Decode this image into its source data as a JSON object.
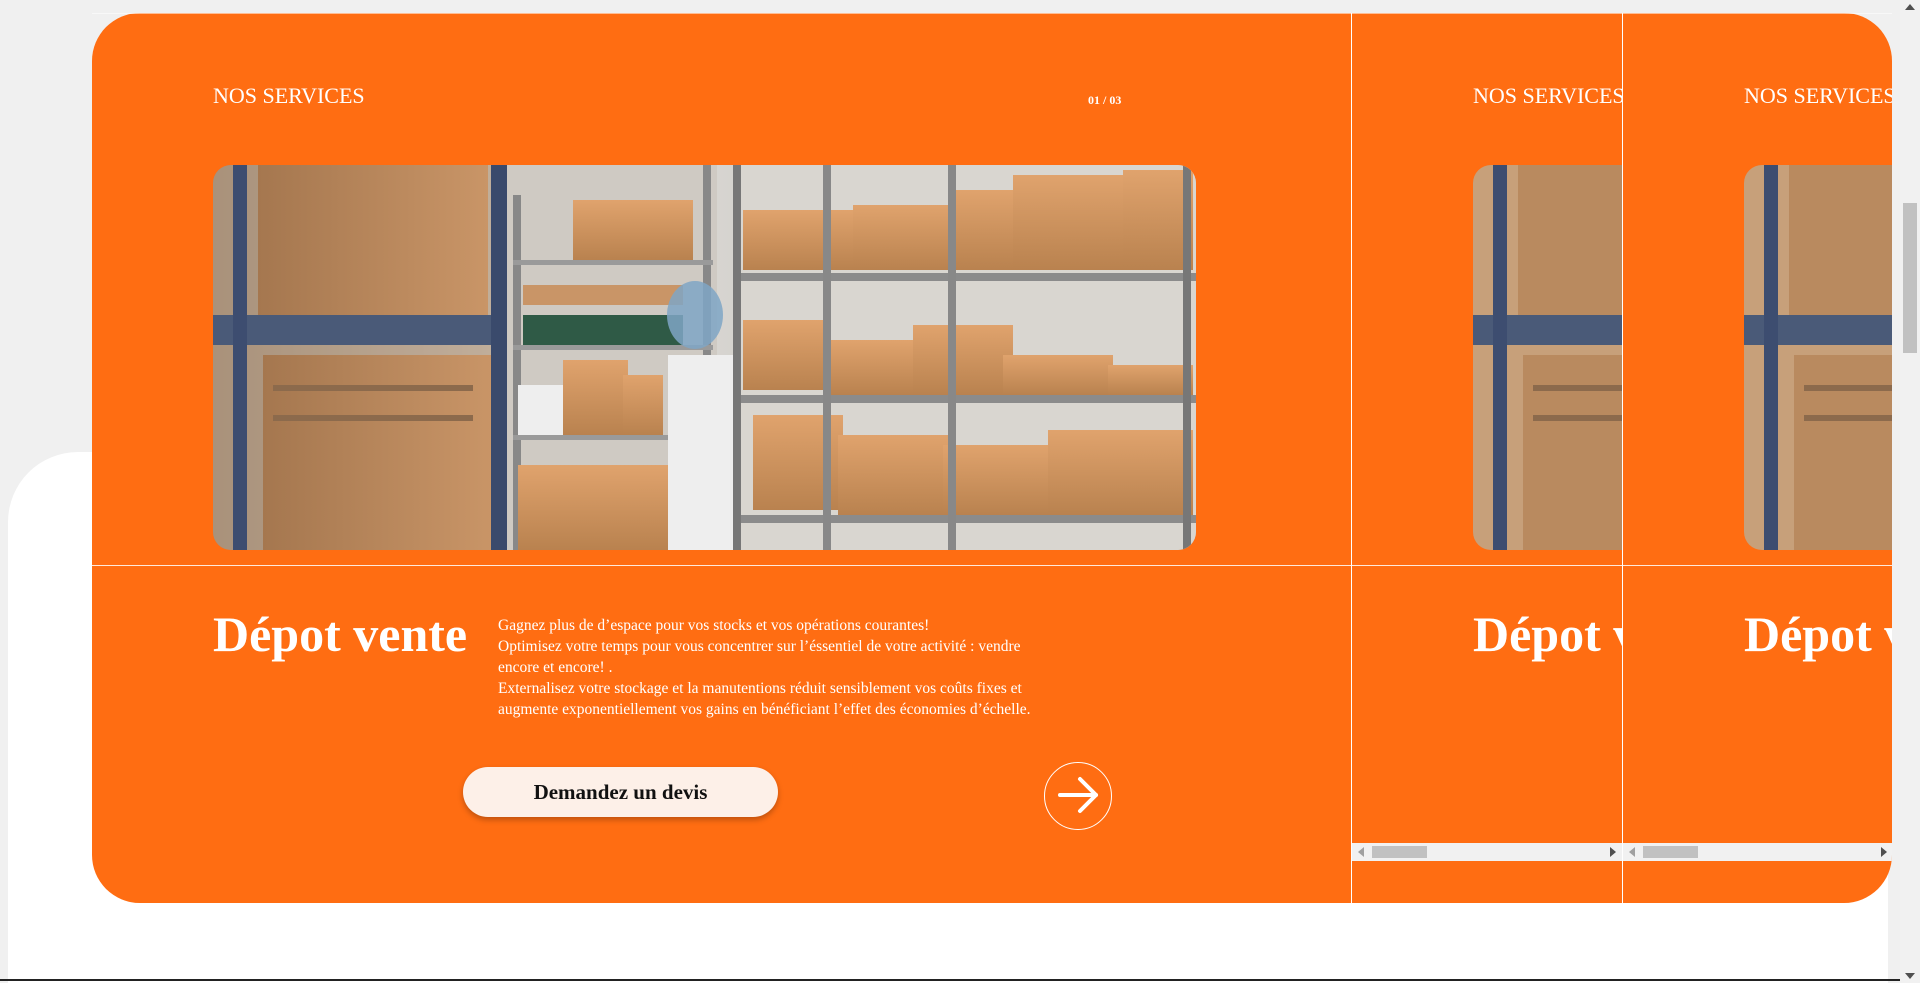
{
  "section_label": "NOS SERVICES",
  "pager": "01 / 03",
  "photo_alt": "warehouse-shelves-photo",
  "service": {
    "heading": "Dépot vente",
    "description_lines": [
      "Gagnez plus de d’espace pour vos stocks et vos opérations courantes!",
      "Optimisez votre temps pour vous concentrer sur l’éssentiel de votre activité : vendre encore et encore! .",
      "Externalisez votre stockage et la manutentions réduit sensiblement vos coûts fixes et augmente exponentiellement vos gains en bénéficiant l’effet des économies d’échelle."
    ],
    "cta_label": "Demandez un devis"
  },
  "colors": {
    "accent": "#ff6d12",
    "cta_bg": "#fdf0e8",
    "page_bg": "#f0f0f0"
  },
  "icons": {
    "next": "arrow-right-icon"
  }
}
